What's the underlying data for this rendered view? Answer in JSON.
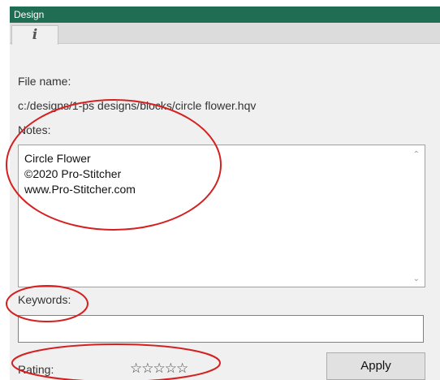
{
  "window": {
    "title": "Design"
  },
  "tabs": [
    {
      "label": "i",
      "icon": "info-icon",
      "selected": true
    }
  ],
  "file": {
    "label": "File name:",
    "value": "c:/designs/1-ps designs/blocks/circle flower.hqv"
  },
  "notes": {
    "label": "Notes:",
    "value": "Circle Flower\n©2020 Pro-Stitcher\nwww.Pro-Stitcher.com"
  },
  "keywords": {
    "label": "Keywords:",
    "value": ""
  },
  "rating": {
    "label": "Rating:",
    "stars": "☆☆☆☆☆",
    "value": 0,
    "max": 5
  },
  "apply_label": "Apply",
  "colors": {
    "title_bar": "#1f6e53",
    "annotation": "#d42020"
  }
}
